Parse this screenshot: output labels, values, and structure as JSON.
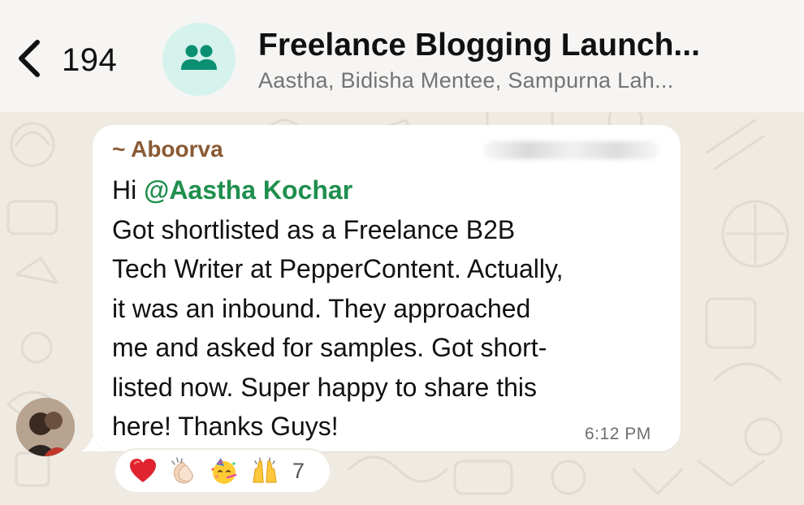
{
  "header": {
    "back_count": "194",
    "title": "Freelance Blogging Launch...",
    "subtitle": "Aastha, Bidisha Mentee, Sampurna Lah..."
  },
  "message": {
    "sender": "~ Aboorva",
    "greeting": "Hi ",
    "mention": "@Aastha Kochar",
    "lines": [
      "Got shortlisted as a  Freelance B2B",
      "Tech Writer at PepperContent. Actually,",
      "it was an inbound. They approached",
      "me and asked for samples. Got short-",
      "listed now. Super happy to share this",
      "here! Thanks Guys!"
    ],
    "time": "6:12 PM"
  },
  "reactions": {
    "emojis": [
      "red-heart",
      "clapping-hands",
      "partying-face",
      "raising-hands"
    ],
    "count": "7"
  },
  "colors": {
    "header_bg": "#f6f5f3",
    "wallpaper": "#efeae2",
    "sender_name": "#8a5a34",
    "mention": "#1f8f4e",
    "avatar_bg": "#d5f2ec",
    "avatar_icon": "#0a8f73"
  }
}
